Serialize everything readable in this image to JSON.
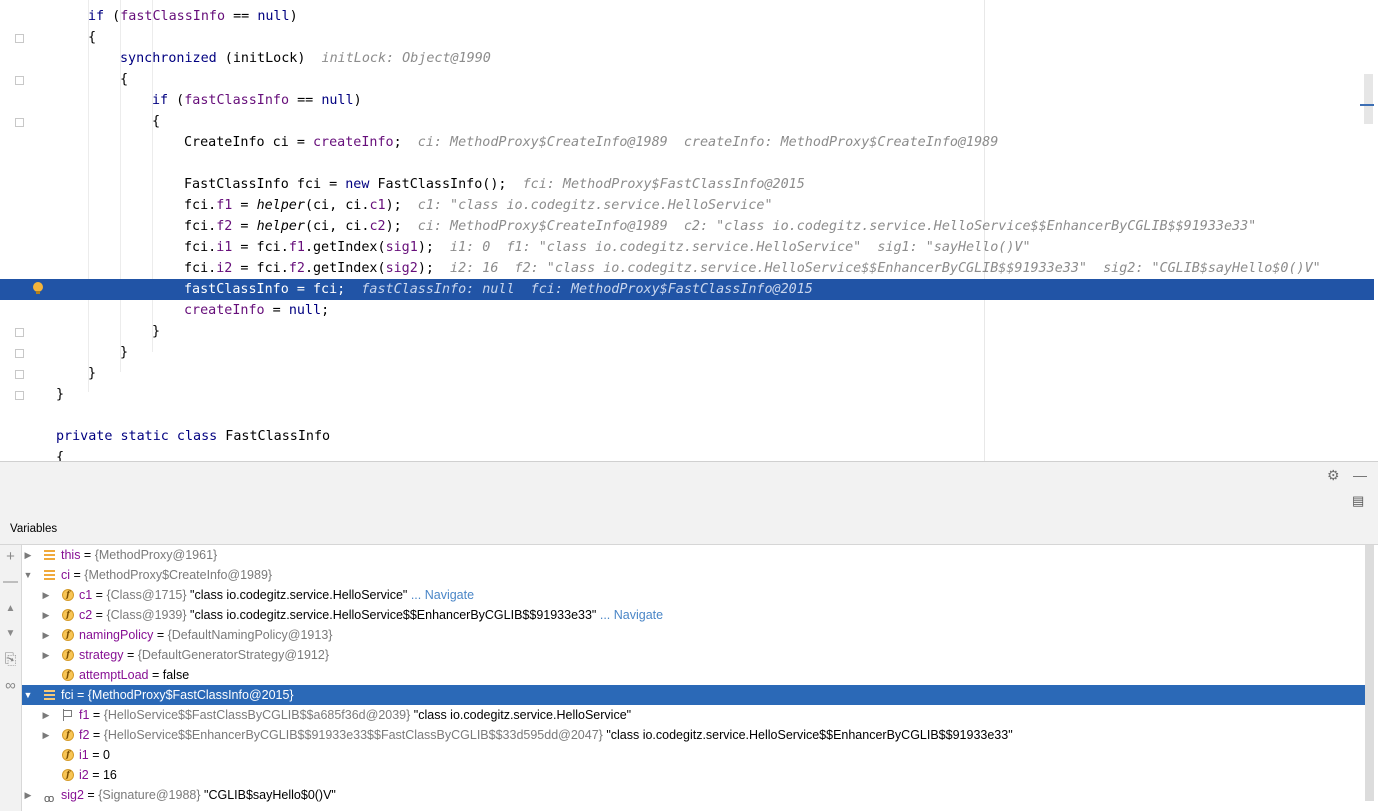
{
  "editor": {
    "lines": [
      {
        "i": 16,
        "toks": [
          [
            "kw",
            "if"
          ],
          [
            "p",
            " ("
          ],
          [
            "fld",
            "fastClassInfo"
          ],
          [
            "p",
            " == "
          ],
          [
            "kw",
            "null"
          ],
          [
            "p",
            ")"
          ]
        ]
      },
      {
        "i": 16,
        "toks": [
          [
            "p",
            "{"
          ]
        ]
      },
      {
        "i": 29,
        "toks": [
          [
            "kw",
            "synchronized"
          ],
          [
            "p",
            " (initLock)"
          ]
        ],
        "hint": "initLock: Object@1990"
      },
      {
        "i": 29,
        "toks": [
          [
            "p",
            "{"
          ]
        ]
      },
      {
        "i": 42,
        "toks": [
          [
            "kw",
            "if"
          ],
          [
            "p",
            " ("
          ],
          [
            "fld",
            "fastClassInfo"
          ],
          [
            "p",
            " == "
          ],
          [
            "kw",
            "null"
          ],
          [
            "p",
            ")"
          ]
        ]
      },
      {
        "i": 42,
        "toks": [
          [
            "p",
            "{"
          ]
        ]
      },
      {
        "i": 55,
        "toks": [
          [
            "p",
            "CreateInfo ci = "
          ],
          [
            "fld",
            "createInfo"
          ],
          [
            "p",
            ";"
          ]
        ],
        "hint": "ci: MethodProxy$CreateInfo@1989  createInfo: MethodProxy$CreateInfo@1989"
      },
      {
        "i": 55,
        "toks": []
      },
      {
        "i": 55,
        "toks": [
          [
            "p",
            "FastClassInfo fci = "
          ],
          [
            "kw",
            "new"
          ],
          [
            "p",
            " FastClassInfo();"
          ]
        ],
        "hint": "fci: MethodProxy$FastClassInfo@2015"
      },
      {
        "i": 55,
        "toks": [
          [
            "p",
            "fci."
          ],
          [
            "fld",
            "f1"
          ],
          [
            "p",
            " = "
          ],
          [
            "mth",
            "helper"
          ],
          [
            "p",
            "(ci, ci."
          ],
          [
            "fld",
            "c1"
          ],
          [
            "p",
            ");"
          ]
        ],
        "hint": "c1: \"class io.codegitz.service.HelloService\""
      },
      {
        "i": 55,
        "toks": [
          [
            "p",
            "fci."
          ],
          [
            "fld",
            "f2"
          ],
          [
            "p",
            " = "
          ],
          [
            "mth",
            "helper"
          ],
          [
            "p",
            "(ci, ci."
          ],
          [
            "fld",
            "c2"
          ],
          [
            "p",
            ");"
          ]
        ],
        "hint": "ci: MethodProxy$CreateInfo@1989  c2: \"class io.codegitz.service.HelloService$$EnhancerByCGLIB$$91933e33\""
      },
      {
        "i": 55,
        "toks": [
          [
            "p",
            "fci."
          ],
          [
            "fld",
            "i1"
          ],
          [
            "p",
            " = fci."
          ],
          [
            "fld",
            "f1"
          ],
          [
            "p",
            ".getIndex("
          ],
          [
            "fld",
            "sig1"
          ],
          [
            "p",
            ");"
          ]
        ],
        "hint": "i1: 0  f1: \"class io.codegitz.service.HelloService\"  sig1: \"sayHello()V\""
      },
      {
        "i": 55,
        "toks": [
          [
            "p",
            "fci."
          ],
          [
            "fld",
            "i2"
          ],
          [
            "p",
            " = fci."
          ],
          [
            "fld",
            "f2"
          ],
          [
            "p",
            ".getIndex("
          ],
          [
            "fld",
            "sig2"
          ],
          [
            "p",
            ");"
          ]
        ],
        "hint": "i2: 16  f2: \"class io.codegitz.service.HelloService$$EnhancerByCGLIB$$91933e33\"  sig2: \"CGLIB$sayHello$0()V\""
      },
      {
        "i": 55,
        "toks": [
          [
            "fld",
            "fastClassInfo"
          ],
          [
            "p",
            " = fci;"
          ]
        ],
        "hint": "fastClassInfo: null  fci: MethodProxy$FastClassInfo@2015",
        "exec": true
      },
      {
        "i": 55,
        "toks": [
          [
            "fld",
            "createInfo"
          ],
          [
            "p",
            " = "
          ],
          [
            "kw",
            "null"
          ],
          [
            "p",
            ";"
          ]
        ]
      },
      {
        "i": 42,
        "toks": [
          [
            "p",
            "}"
          ]
        ]
      },
      {
        "i": 29,
        "toks": [
          [
            "p",
            "}"
          ]
        ]
      },
      {
        "i": 16,
        "toks": [
          [
            "p",
            "}"
          ]
        ]
      },
      {
        "i": 3,
        "toks": [
          [
            "p",
            "}"
          ]
        ]
      },
      {
        "i": 3,
        "toks": []
      },
      {
        "i": 3,
        "toks": [
          [
            "kw",
            "private static class"
          ],
          [
            "p",
            " FastClassInfo"
          ]
        ]
      },
      {
        "i": 3,
        "toks": [
          [
            "p",
            "{"
          ]
        ]
      }
    ]
  },
  "debug": {
    "title": "Variables",
    "settings_icon": "⚙",
    "minimize_icon": "—",
    "layout_icon": "▤",
    "tools": [
      "+",
      "—",
      "▲",
      "▼",
      "⎘",
      "∞"
    ],
    "rows": [
      {
        "d": 0,
        "tog": "▶",
        "ic": "list",
        "name": "this",
        "type": "{MethodProxy@1961}",
        "val": "",
        "nav": ""
      },
      {
        "d": 0,
        "tog": "▼",
        "ic": "list",
        "name": "ci",
        "type": "{MethodProxy$CreateInfo@1989}",
        "val": "",
        "nav": ""
      },
      {
        "d": 1,
        "tog": "▶",
        "ic": "field",
        "name": "c1",
        "type": "{Class@1715}",
        "val": "\"class io.codegitz.service.HelloService\"",
        "nav": "... Navigate"
      },
      {
        "d": 1,
        "tog": "▶",
        "ic": "field",
        "name": "c2",
        "type": "{Class@1939}",
        "val": "\"class io.codegitz.service.HelloService$$EnhancerByCGLIB$$91933e33\"",
        "nav": "... Navigate"
      },
      {
        "d": 1,
        "tog": "▶",
        "ic": "field",
        "name": "namingPolicy",
        "type": "{DefaultNamingPolicy@1913}",
        "val": "",
        "nav": ""
      },
      {
        "d": 1,
        "tog": "▶",
        "ic": "field",
        "name": "strategy",
        "type": "{DefaultGeneratorStrategy@1912}",
        "val": "",
        "nav": ""
      },
      {
        "d": 1,
        "tog": "",
        "ic": "field",
        "name": "attemptLoad",
        "type": "",
        "val": "false",
        "nav": ""
      },
      {
        "d": 0,
        "tog": "▼",
        "ic": "list",
        "name": "fci",
        "type": "{MethodProxy$FastClassInfo@2015}",
        "val": "",
        "nav": "",
        "sel": true
      },
      {
        "d": 1,
        "tog": "▶",
        "ic": "flag",
        "name": "f1",
        "type": "{HelloService$$FastClassByCGLIB$$a685f36d@2039}",
        "val": "\"class io.codegitz.service.HelloService\"",
        "nav": ""
      },
      {
        "d": 1,
        "tog": "▶",
        "ic": "field",
        "name": "f2",
        "type": "{HelloService$$EnhancerByCGLIB$$91933e33$$FastClassByCGLIB$$33d595dd@2047}",
        "val": "\"class io.codegitz.service.HelloService$$EnhancerByCGLIB$$91933e33\"",
        "nav": ""
      },
      {
        "d": 1,
        "tog": "",
        "ic": "field",
        "name": "i1",
        "type": "",
        "val": "0",
        "nav": ""
      },
      {
        "d": 1,
        "tog": "",
        "ic": "field",
        "name": "i2",
        "type": "",
        "val": "16",
        "nav": ""
      },
      {
        "d": 0,
        "tog": "▶",
        "ic": "watch",
        "name": "sig2",
        "type": "{Signature@1988}",
        "val": "\"CGLIB$sayHello$0()V\"",
        "nav": ""
      }
    ]
  }
}
